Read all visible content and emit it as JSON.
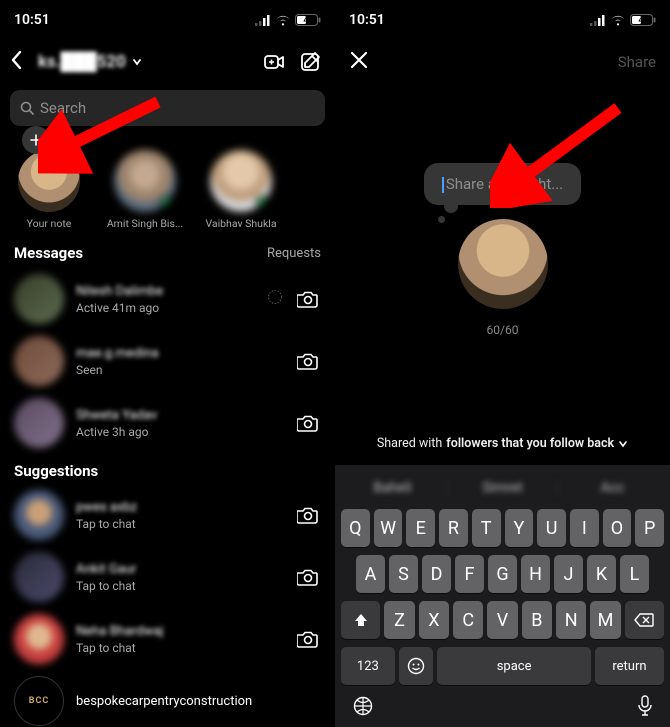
{
  "status": {
    "time": "10:51",
    "battery_text": "43"
  },
  "left": {
    "username": "ks.███520",
    "search_placeholder": "Search",
    "notes": [
      {
        "label": "Your note",
        "own": true
      },
      {
        "label": "Amit Singh Bis...",
        "online": true
      },
      {
        "label": "Vaibhav Shukla",
        "online": true
      }
    ],
    "messages_title": "Messages",
    "requests_label": "Requests",
    "chats": [
      {
        "name": "Nilesh Dalimbe",
        "sub": "Active 41m ago"
      },
      {
        "name": "mae.g.medina",
        "sub": "Seen"
      },
      {
        "name": "Shweta Yadav",
        "sub": "Active 3h ago"
      }
    ],
    "suggestions_title": "Suggestions",
    "suggestions": [
      {
        "name": "pwes axbz",
        "sub": "Tap to chat"
      },
      {
        "name": "Ankit Gaur",
        "sub": "Tap to chat"
      },
      {
        "name": "Neha Bhardwaj",
        "sub": "Tap to chat"
      },
      {
        "name": "bespokecarpentryconstruction",
        "sub": ""
      }
    ]
  },
  "right": {
    "share_label": "Share",
    "placeholder": "Share a thought...",
    "counter": "60/60",
    "audience_prefix": "Shared with ",
    "audience_bold": "followers that you follow back"
  },
  "keyboard": {
    "suggestions": [
      "Baheli",
      "Simret",
      "Acc"
    ],
    "row1": [
      "Q",
      "W",
      "E",
      "R",
      "T",
      "Y",
      "U",
      "I",
      "O",
      "P"
    ],
    "row2": [
      "A",
      "S",
      "D",
      "F",
      "G",
      "H",
      "J",
      "K",
      "L"
    ],
    "row3": [
      "Z",
      "X",
      "C",
      "V",
      "B",
      "N",
      "M"
    ],
    "mode": "123",
    "space": "space",
    "return": "return"
  }
}
